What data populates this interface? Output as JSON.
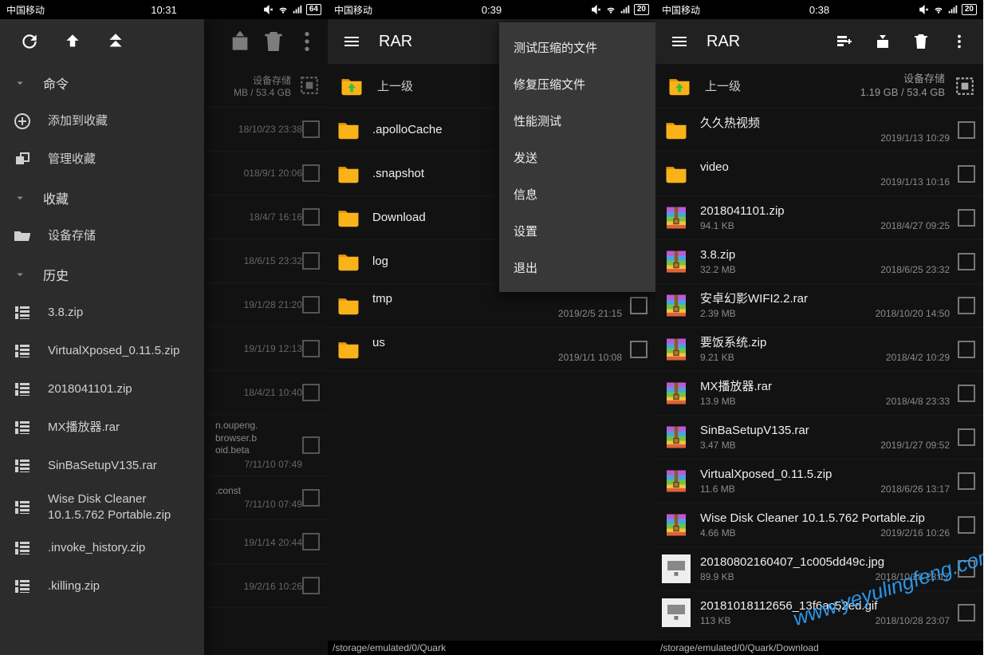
{
  "screen1": {
    "status": {
      "carrier": "中国移动",
      "time": "10:31",
      "battery": "64"
    },
    "drawer": {
      "sections": {
        "commands": {
          "title": "命令",
          "add_fav": "添加到收藏",
          "manage_fav": "管理收藏"
        },
        "favorites": {
          "title": "收藏",
          "device_storage": "设备存储"
        },
        "history": {
          "title": "历史",
          "items": [
            "3.8.zip",
            "VirtualXposed_0.11.5.zip",
            "2018041101.zip",
            "MX播放器.rar",
            "SinBaSetupV135.rar",
            "Wise Disk Cleaner 10.1.5.762 Portable.zip",
            ".invoke_history.zip",
            ".killing.zip"
          ]
        }
      }
    },
    "bg": {
      "storage_label": "设备存储",
      "storage_size": "MB / 53.4 GB",
      "rows": [
        {
          "name": "",
          "date": "18/10/23 23:38"
        },
        {
          "name": "",
          "date": "018/9/1 20:06"
        },
        {
          "name": "",
          "date": "18/4/7 16:16"
        },
        {
          "name": "",
          "date": "18/6/15 23:32"
        },
        {
          "name": "",
          "date": "19/1/28 21:20"
        },
        {
          "name": "",
          "date": "19/1/19 12:13"
        },
        {
          "name": "",
          "date": "18/4/21 10:40"
        },
        {
          "name": "n.oupeng.\nbrowser.b\noid.beta",
          "date": "7/11/10 07:49"
        },
        {
          "name": ".const",
          "date": "7/11/10 07:49"
        },
        {
          "name": "",
          "date": "19/1/14 20:44"
        },
        {
          "name": "",
          "date": "19/2/16 10:26"
        }
      ]
    }
  },
  "screen2": {
    "status": {
      "carrier": "中国移动",
      "time": "0:39",
      "battery": "20"
    },
    "app_title": "RAR",
    "up_label": "上一级",
    "menu": [
      "测试压缩的文件",
      "修复压缩文件",
      "性能测试",
      "发送",
      "信息",
      "设置",
      "退出"
    ],
    "rows": [
      {
        "name": ".apolloCache",
        "type": "folder"
      },
      {
        "name": ".snapshot",
        "type": "folder"
      },
      {
        "name": "Download",
        "type": "folder"
      },
      {
        "name": "log",
        "type": "folder"
      },
      {
        "name": "tmp",
        "type": "folder",
        "date": "2019/2/5 21:15"
      },
      {
        "name": "us",
        "type": "folder",
        "date": "2019/1/1 10:08"
      }
    ],
    "path": "/storage/emulated/0/Quark"
  },
  "screen3": {
    "status": {
      "carrier": "中国移动",
      "time": "0:38",
      "battery": "20"
    },
    "app_title": "RAR",
    "up_label": "上一级",
    "storage_label": "设备存储",
    "storage_size": "1.19 GB / 53.4 GB",
    "rows": [
      {
        "name": "久久热视频",
        "type": "folder",
        "date": "2019/1/13 10:29"
      },
      {
        "name": "video",
        "type": "folder",
        "date": "2019/1/13 10:16"
      },
      {
        "name": "2018041101.zip",
        "type": "archive",
        "size": "94.1 KB",
        "date": "2018/4/27 09:25"
      },
      {
        "name": "3.8.zip",
        "type": "archive",
        "size": "32.2 MB",
        "date": "2018/6/25 23:32"
      },
      {
        "name": "安卓幻影WIFI2.2.rar",
        "type": "archive",
        "size": "2.39 MB",
        "date": "2018/10/20 14:50"
      },
      {
        "name": "要饭系统.zip",
        "type": "archive",
        "size": "9.21 KB",
        "date": "2018/4/2 10:29"
      },
      {
        "name": "MX播放器.rar",
        "type": "archive",
        "size": "13.9 MB",
        "date": "2018/4/8 23:33"
      },
      {
        "name": "SinBaSetupV135.rar",
        "type": "archive",
        "size": "3.47 MB",
        "date": "2019/1/27 09:52"
      },
      {
        "name": "VirtualXposed_0.11.5.zip",
        "type": "archive",
        "size": "11.6 MB",
        "date": "2018/6/26 13:17"
      },
      {
        "name": "Wise Disk Cleaner 10.1.5.762 Portable.zip",
        "type": "archive",
        "size": "4.66 MB",
        "date": "2019/2/16 10:26"
      },
      {
        "name": "20180802160407_1c005dd49c.jpg",
        "type": "image",
        "size": "89.9 KB",
        "date": "2018/10/28 23:17"
      },
      {
        "name": "20181018112656_13f6ac52ed.gif",
        "type": "image",
        "size": "113 KB",
        "date": "2018/10/28 23:07"
      }
    ],
    "path": "/storage/emulated/0/Quark/Download",
    "watermark": "www.yeyulingfeng.com"
  }
}
